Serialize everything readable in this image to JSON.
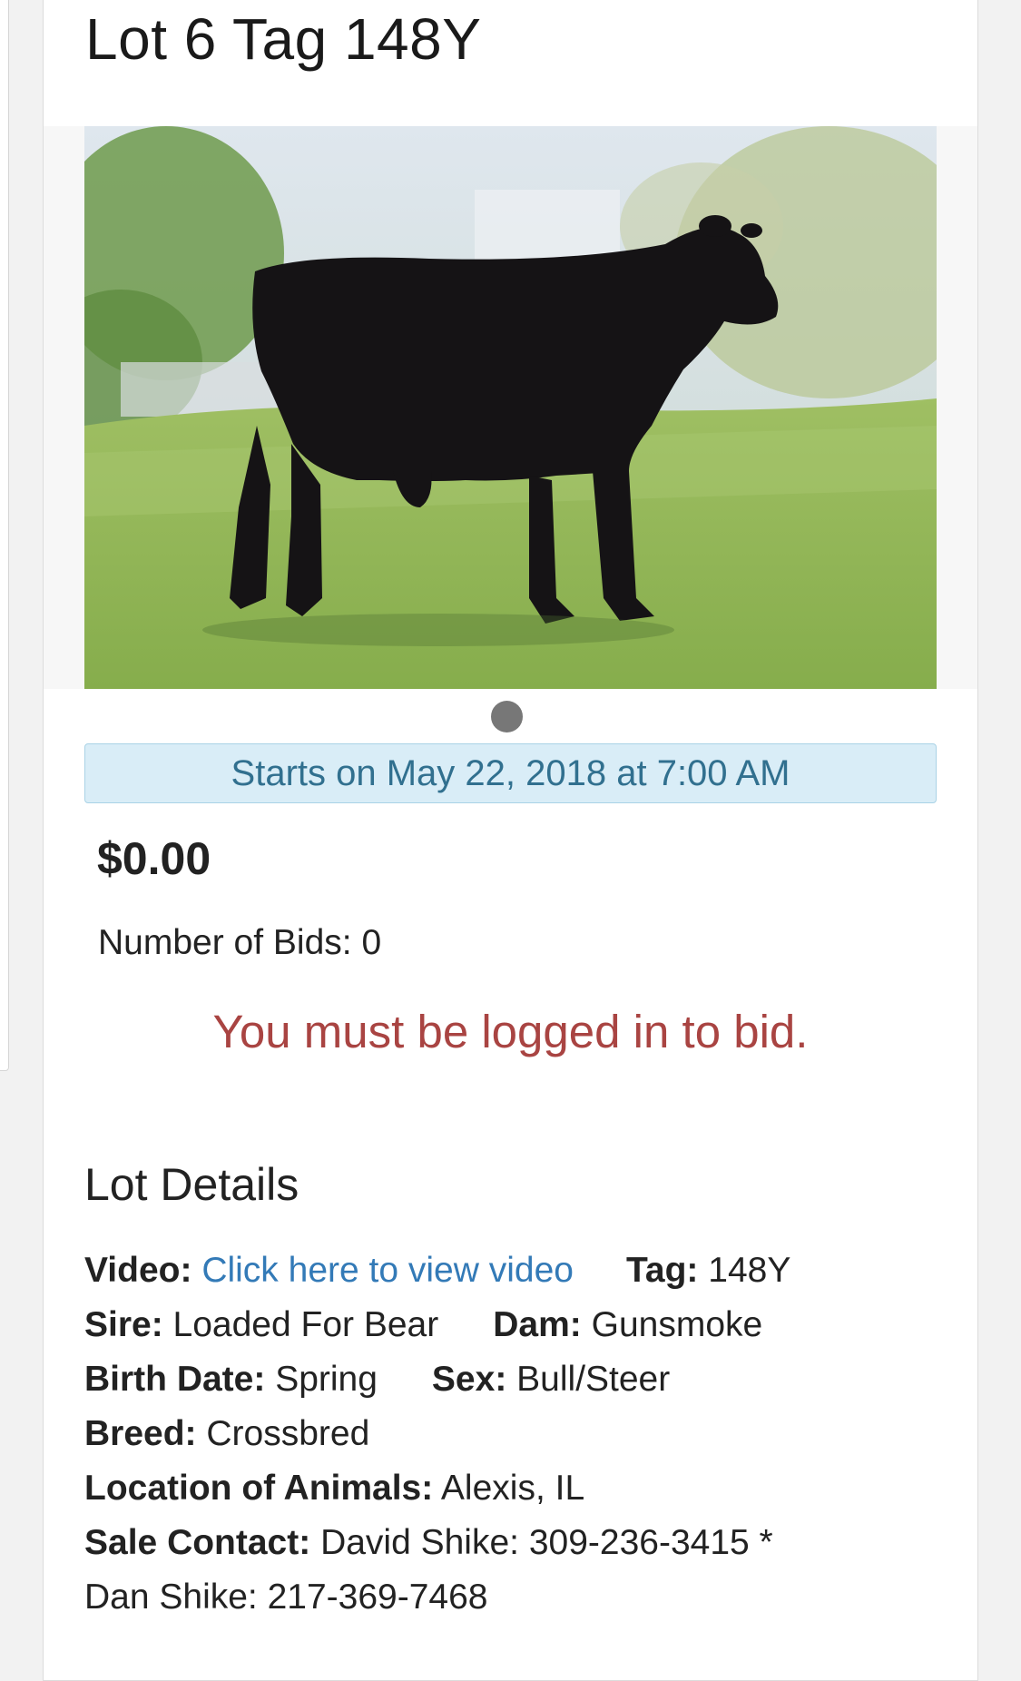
{
  "lot": {
    "title": "Lot 6 Tag 148Y"
  },
  "auction": {
    "start_notice": "Starts on May 22, 2018 at 7:00 AM",
    "price": "$0.00",
    "bids_label": "Number of Bids:",
    "bids_count": "0",
    "login_message": "You must be logged in to bid."
  },
  "details": {
    "heading": "Lot Details",
    "video_label": "Video:",
    "video_link": "Click here to view video",
    "tag_label": "Tag:",
    "tag_value": "148Y",
    "sire_label": "Sire:",
    "sire_value": "Loaded For Bear",
    "dam_label": "Dam:",
    "dam_value": "Gunsmoke",
    "birth_label": "Birth Date:",
    "birth_value": "Spring",
    "sex_label": "Sex:",
    "sex_value": "Bull/Steer",
    "breed_label": "Breed:",
    "breed_value": "Crossbred",
    "location_label": "Location of Animals:",
    "location_value": "Alexis, IL",
    "contact_label": "Sale Contact:",
    "contact_value_1": "David Shike: 309-236-3415 *",
    "contact_value_2": "Dan Shike: 217-369-7468"
  },
  "colors": {
    "notice_bg": "#d9edf7",
    "notice_text": "#31708f",
    "alert_text": "#a94442",
    "link": "#337ab7"
  }
}
